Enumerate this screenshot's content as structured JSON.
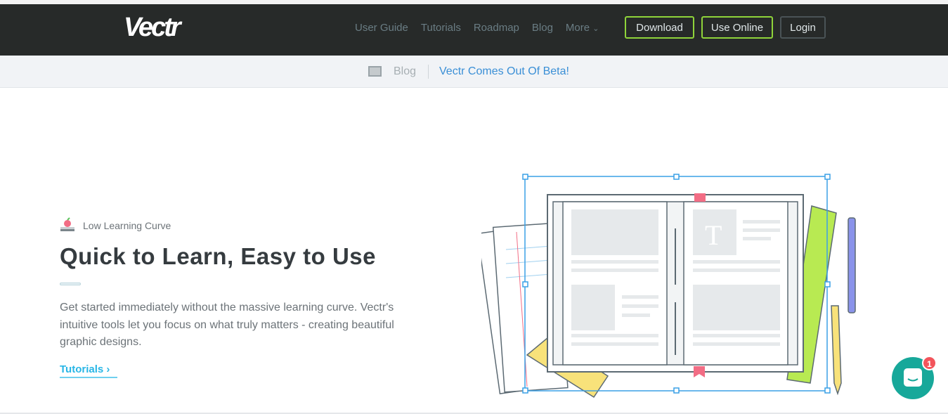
{
  "brand": "Vectr",
  "nav": {
    "links": [
      "User Guide",
      "Tutorials",
      "Roadmap",
      "Blog",
      "More"
    ],
    "more_chevron": "⌄",
    "download": "Download",
    "use_online": "Use Online",
    "login": "Login"
  },
  "announcement": {
    "section": "Blog",
    "post": "Vectr Comes Out Of Beta!"
  },
  "hero": {
    "eyebrow": "Low Learning Curve",
    "title": "Quick to Learn, Easy to Use",
    "body": "Get started immediately without the massive learning curve. Vectr's intuitive tools let you focus on what truly matters - creating beautiful graphic designs.",
    "link": "Tutorials",
    "link_chevron": "›"
  },
  "chat": {
    "badge_count": "1"
  },
  "colors": {
    "nav_bg": "#272a29",
    "accent_green": "#8fd43a",
    "link_blue": "#28b6e6",
    "chat": "#17a89a"
  }
}
